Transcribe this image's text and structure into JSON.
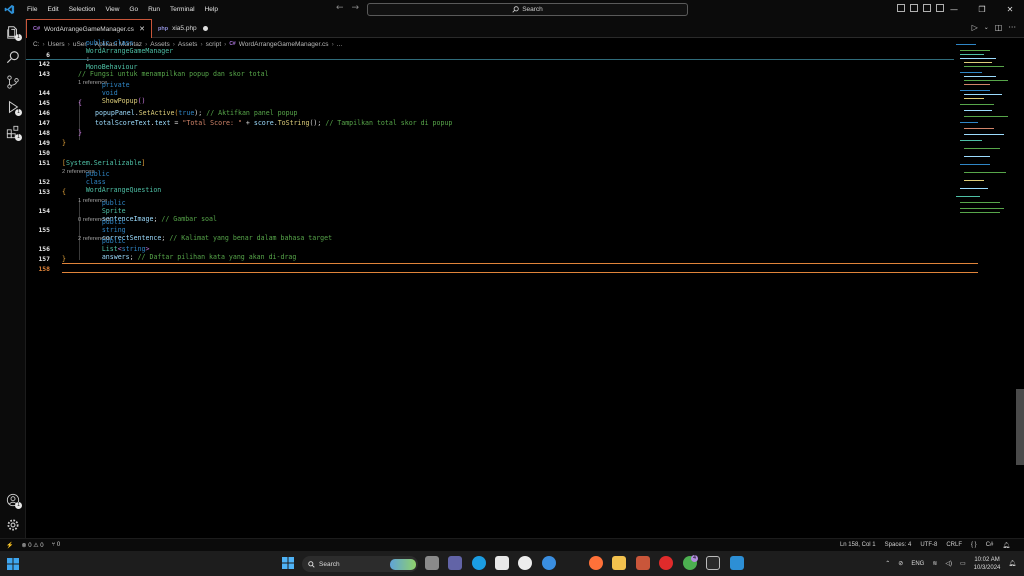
{
  "menu": [
    "File",
    "Edit",
    "Selection",
    "View",
    "Go",
    "Run",
    "Terminal",
    "Help"
  ],
  "command_center": {
    "label": "Search"
  },
  "window_controls": {
    "minimize": "—",
    "restore": "❐",
    "close": "✕"
  },
  "activity_badges": {
    "explorer": "1",
    "run": "1",
    "extensions": "1",
    "accounts": "1"
  },
  "tabs": [
    {
      "label": "WordArrangeGameManager.cs",
      "active": true
    },
    {
      "label": "xia5.php",
      "modified": true
    }
  ],
  "breadcrumb": [
    "C:",
    "Users",
    "uSer",
    "Aplikasi Mumtaz",
    "Assets",
    "Assets",
    "script",
    "WordArrangeGameManager.cs",
    "..."
  ],
  "sticky": {
    "line": "6",
    "text_kw": "public class",
    "text_name": "WordArrangeGameManager",
    "text_sep": ":",
    "text_base": "MonoBehaviour"
  },
  "code": {
    "l142": "142",
    "l143": "143",
    "l144": "144",
    "l145": "145",
    "l146": "146",
    "l147": "147",
    "l148": "148",
    "l149": "149",
    "l150": "150",
    "l151": "151",
    "l152": "152",
    "l153": "153",
    "l154": "154",
    "l155": "155",
    "l156": "156",
    "l157": "157",
    "l158": "158",
    "c143": "// Fungsi untuk menampilkan popup dan skor total",
    "r144": "1 reference",
    "c146_a": "popupPanel",
    "c146_b": ".",
    "c146_c": "SetActive",
    "c146_d": "(",
    "c146_e": "true",
    "c146_f": ");",
    "c146_g": " // Aktifkan panel popup",
    "c147_a": "totalScoreText",
    "c147_b": ".",
    "c147_c": "text",
    "c147_d": " = ",
    "c147_e": "\"Total Score: \"",
    "c147_f": " + ",
    "c147_g": "score",
    "c147_h": ".",
    "c147_i": "ToString",
    "c147_j": "();",
    "c147_k": " // Tampilkan total skor di popup",
    "c151": "System.Serializable",
    "r152": "2 references",
    "r154": "1 reference",
    "c154_name": "sentenceImage",
    "c154_cm": " // Gambar soal",
    "r155": "0 references",
    "c155_name": "correctSentence",
    "c155_cm": " // Kalimat yang benar dalam bahasa target",
    "r156": "2 references",
    "c156_name": "answers",
    "c156_cm": " // Daftar pilihan kata yang akan di-drag"
  },
  "tokens": {
    "public": "public",
    "private": "private",
    "void": "void",
    "class": "class",
    "string": "string",
    "true": "true",
    "show_popup": "ShowPopup",
    "paren": "()",
    "word_question": "WordArrangeQuestion",
    "sprite": "Sprite",
    "list": "List",
    "lt": "<",
    "gt": ">",
    "semi": ";",
    "open_brace": "{",
    "close_brace": "}",
    "open_sq": "[",
    "close_sq": "]"
  },
  "status": {
    "errors": "0",
    "warnings": "0",
    "ports": "0",
    "position": "Ln 158, Col 1",
    "spaces": "Spaces: 4",
    "encoding": "UTF-8",
    "eol": "CRLF",
    "braces": "{ }",
    "language": "C#"
  },
  "taskbar": {
    "search": "Search",
    "lang": "ENG",
    "time": "10:02 AM",
    "date": "10/3/2024",
    "notif_badge": "4"
  },
  "colors": {
    "accent": "#c9563a",
    "current_line": "#e0843a",
    "keyword": "#2f86c6",
    "type": "#4ec0a6",
    "comment": "#57a64a",
    "string": "#d2856a"
  }
}
